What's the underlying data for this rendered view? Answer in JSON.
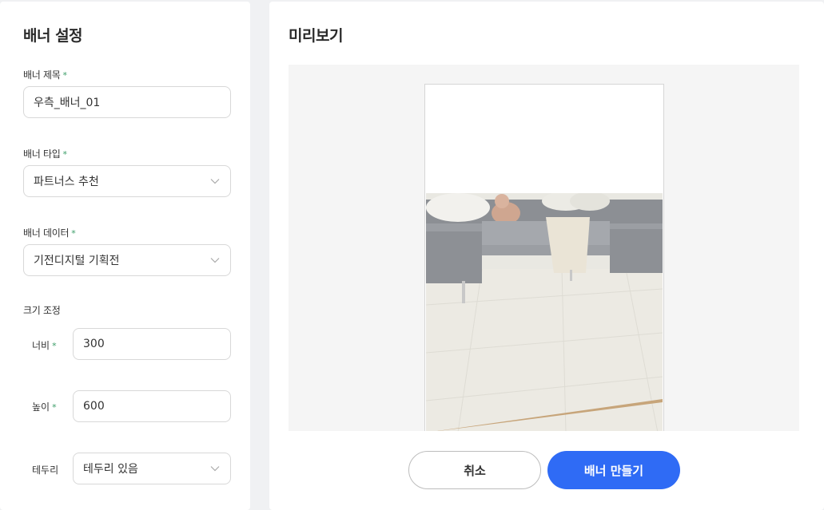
{
  "settings": {
    "title": "배너 설정",
    "banner_title": {
      "label": "배너 제목",
      "required": "*",
      "value": "우측_배너_01"
    },
    "banner_type": {
      "label": "배너 타입",
      "required": "*",
      "value": "파트너스 추천"
    },
    "banner_data": {
      "label": "배너 데이터",
      "required": "*",
      "value": "기전디지털 기획전"
    },
    "size": {
      "label": "크기 조정",
      "width": {
        "label": "너비",
        "required": "*",
        "value": "300"
      },
      "height": {
        "label": "높이",
        "required": "*",
        "value": "600"
      }
    },
    "border": {
      "label": "테두리",
      "value": "테두리 있음"
    }
  },
  "preview": {
    "title": "미리보기"
  },
  "actions": {
    "cancel_label": "취소",
    "create_label": "배너 만들기"
  },
  "colors": {
    "accent": "#2f6bf5",
    "required": "#3b9d68"
  },
  "icons": {
    "select_chevron": "chevron-down-icon"
  }
}
